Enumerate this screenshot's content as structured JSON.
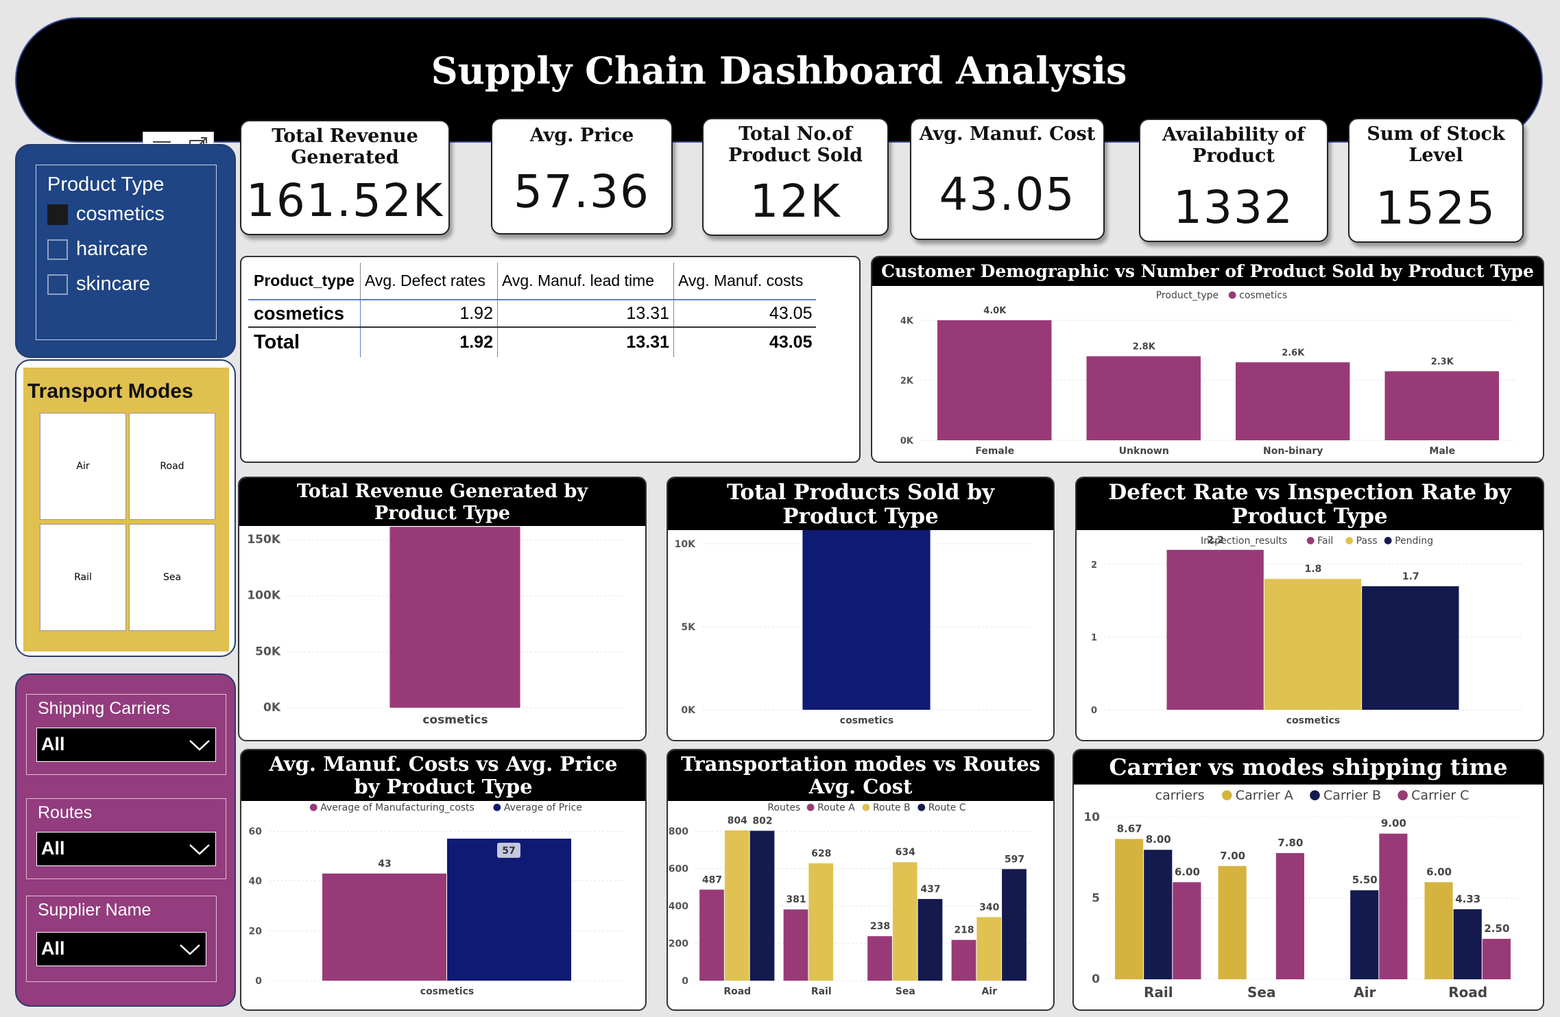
{
  "title": "Supply Chain Dashboard Analysis",
  "kpis": [
    {
      "label": "Total Revenue Generated",
      "value": "161.52K"
    },
    {
      "label": "Avg. Price",
      "value": "57.36"
    },
    {
      "label": "Total No.of Product Sold",
      "value": "12K"
    },
    {
      "label": "Avg. Manuf. Cost",
      "value": "43.05"
    },
    {
      "label": "Availability of Product",
      "value": "1332"
    },
    {
      "label": "Sum of Stock Level",
      "value": "1525"
    }
  ],
  "product_slicer": {
    "title": "Product Type",
    "items": [
      "cosmetics",
      "haircare",
      "skincare"
    ],
    "selected": "cosmetics"
  },
  "transport_slicer": {
    "title": "Transport Modes",
    "tiles": [
      "Air",
      "Road",
      "Rail",
      "Sea"
    ]
  },
  "filters": [
    {
      "label": "Shipping Carriers",
      "value": "All"
    },
    {
      "label": "Routes",
      "value": "All"
    },
    {
      "label": "Supplier Name",
      "value": "All"
    }
  ],
  "table": {
    "headers": [
      "Product_type",
      "Avg. Defect rates",
      "Avg. Manuf. lead time",
      "Avg. Manuf. costs"
    ],
    "rows": [
      [
        "cosmetics",
        "1.92",
        "13.31",
        "43.05"
      ]
    ],
    "total": [
      "Total",
      "1.92",
      "13.31",
      "43.05"
    ]
  },
  "colors": {
    "magenta": "#993a78",
    "gold": "#dfc252",
    "navy": "#0f1a75",
    "darknavy": "#141a4e",
    "slicer_blue": "#1f4584",
    "slicer_gold": "#e0c04f",
    "slicer_purple": "#933c7e"
  },
  "chart_data": [
    {
      "id": "demographic",
      "type": "bar",
      "title": "Customer Demographic vs Number of Product Sold by Product Type",
      "legend_title": "Product_type",
      "categories": [
        "Female",
        "Unknown",
        "Non-binary",
        "Male"
      ],
      "series": [
        {
          "name": "cosmetics",
          "values": [
            4000,
            2800,
            2600,
            2300
          ],
          "labels": [
            "4.0K",
            "2.8K",
            "2.6K",
            "2.3K"
          ],
          "color": "#993a78"
        }
      ],
      "yticks": [
        "0K",
        "2K",
        "4K"
      ],
      "ylim": [
        0,
        4000
      ]
    },
    {
      "id": "revenue",
      "type": "bar",
      "title": "Total Revenue Generated by Product Type",
      "categories": [
        "cosmetics"
      ],
      "series": [
        {
          "values": [
            161500
          ],
          "labels": [
            "161.5K"
          ],
          "color": "#993a78"
        }
      ],
      "yticks": [
        "0K",
        "50K",
        "100K",
        "150K"
      ],
      "ylim": [
        0,
        150000
      ]
    },
    {
      "id": "products",
      "type": "bar",
      "title": "Total Products Sold by Product Type",
      "categories": [
        "cosmetics"
      ],
      "series": [
        {
          "values": [
            11800
          ],
          "labels": [
            "11.8K"
          ],
          "color": "#0f1a75"
        }
      ],
      "yticks": [
        "0K",
        "5K",
        "10K"
      ],
      "ylim": [
        0,
        10000
      ]
    },
    {
      "id": "defect",
      "type": "bar",
      "title": "Defect Rate vs Inspection Rate by Product Type",
      "legend_title": "Inspection_results",
      "categories": [
        "cosmetics"
      ],
      "series": [
        {
          "name": "Fail",
          "values": [
            2.2
          ],
          "labels": [
            "2.2"
          ],
          "color": "#993a78"
        },
        {
          "name": "Pass",
          "values": [
            1.8
          ],
          "labels": [
            "1.8"
          ],
          "color": "#dfc252"
        },
        {
          "name": "Pending",
          "values": [
            1.7
          ],
          "labels": [
            "1.7"
          ],
          "color": "#141a4e"
        }
      ],
      "yticks": [
        "0",
        "1",
        "2"
      ],
      "ylim": [
        0,
        2
      ]
    },
    {
      "id": "costprice",
      "type": "bar",
      "title": "Avg. Manuf. Costs vs Avg. Price by Product Type",
      "categories": [
        "cosmetics"
      ],
      "series": [
        {
          "name": "Average of Manufacturing_costs",
          "values": [
            43
          ],
          "labels": [
            "43"
          ],
          "color": "#993a78"
        },
        {
          "name": "Average of Price",
          "values": [
            57
          ],
          "labels": [
            "57"
          ],
          "color": "#0f1a75"
        }
      ],
      "yticks": [
        "0",
        "20",
        "40",
        "60"
      ],
      "ylim": [
        0,
        60
      ]
    },
    {
      "id": "routes",
      "type": "bar",
      "title": "Transportation modes vs Routes Avg. Cost",
      "legend_title": "Routes",
      "categories": [
        "Road",
        "Rail",
        "Sea",
        "Air"
      ],
      "series": [
        {
          "name": "Route A",
          "values": [
            487,
            381,
            238,
            218
          ],
          "labels": [
            "487",
            "381",
            "238",
            "218"
          ],
          "color": "#993a78"
        },
        {
          "name": "Route B",
          "values": [
            804,
            628,
            634,
            340
          ],
          "labels": [
            "804",
            "628",
            "634",
            "340"
          ],
          "color": "#dfc252"
        },
        {
          "name": "Route C",
          "values": [
            802,
            null,
            437,
            597
          ],
          "labels": [
            "802",
            "",
            "437",
            "597"
          ],
          "color": "#141a4e"
        }
      ],
      "yticks": [
        "0",
        "200",
        "400",
        "600",
        "800"
      ],
      "ylim": [
        0,
        800
      ]
    },
    {
      "id": "carriers",
      "type": "bar",
      "title": "Carrier vs modes shipping time",
      "legend_title": "carriers",
      "categories": [
        "Rail",
        "Sea",
        "Air",
        "Road"
      ],
      "series": [
        {
          "name": "Carrier A",
          "values": [
            8.67,
            7.0,
            null,
            6.0
          ],
          "labels": [
            "8.67",
            "7.00",
            "",
            "6.00"
          ],
          "color": "#d4b43f"
        },
        {
          "name": "Carrier B",
          "values": [
            8.0,
            null,
            5.5,
            4.33
          ],
          "labels": [
            "8.00",
            "",
            "5.50",
            "4.33"
          ],
          "color": "#141a4e"
        },
        {
          "name": "Carrier C",
          "values": [
            6.0,
            7.8,
            9.0,
            2.5
          ],
          "labels": [
            "6.00",
            "7.80",
            "9.00",
            "2.50"
          ],
          "color": "#993a78"
        }
      ],
      "yticks": [
        "0",
        "5",
        "10"
      ],
      "ylim": [
        0,
        10
      ]
    }
  ]
}
